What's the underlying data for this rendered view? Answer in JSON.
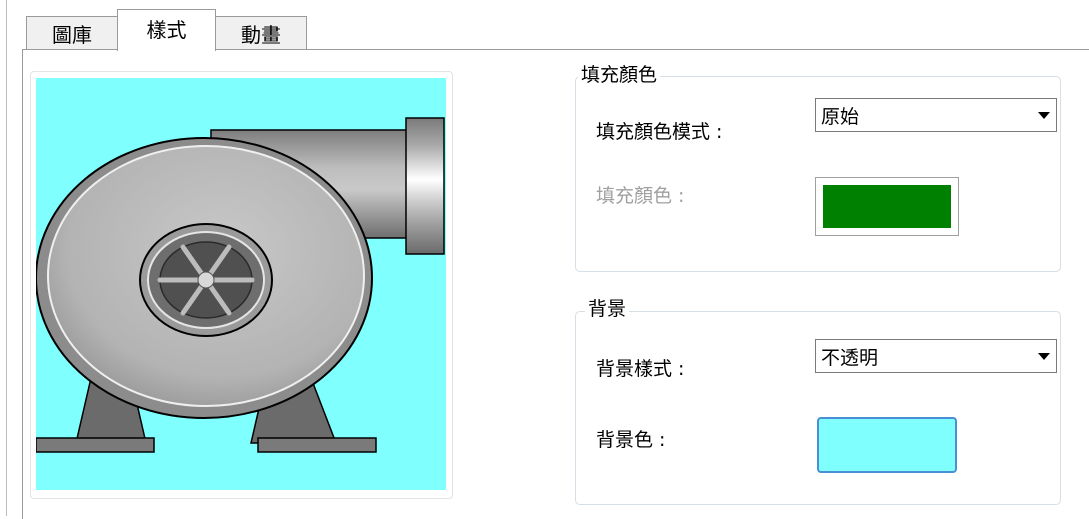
{
  "tabs": [
    {
      "label": "圖庫",
      "active": false
    },
    {
      "label": "樣式",
      "active": true
    },
    {
      "label": "動畫",
      "active": false
    }
  ],
  "preview": {
    "background_color": "#80ffff",
    "image_icon": "centrifugal-fan-blower-icon"
  },
  "fill_group": {
    "title": "填充顏色",
    "mode_label": "填充顏色模式 :",
    "mode_value": "原始",
    "color_label": "填充顏色 :",
    "color_value": "#008000",
    "color_enabled": false
  },
  "background_group": {
    "title": "背景",
    "style_label": "背景樣式 :",
    "style_value": "不透明",
    "color_label": "背景色 :",
    "color_value": "#80ffff"
  }
}
